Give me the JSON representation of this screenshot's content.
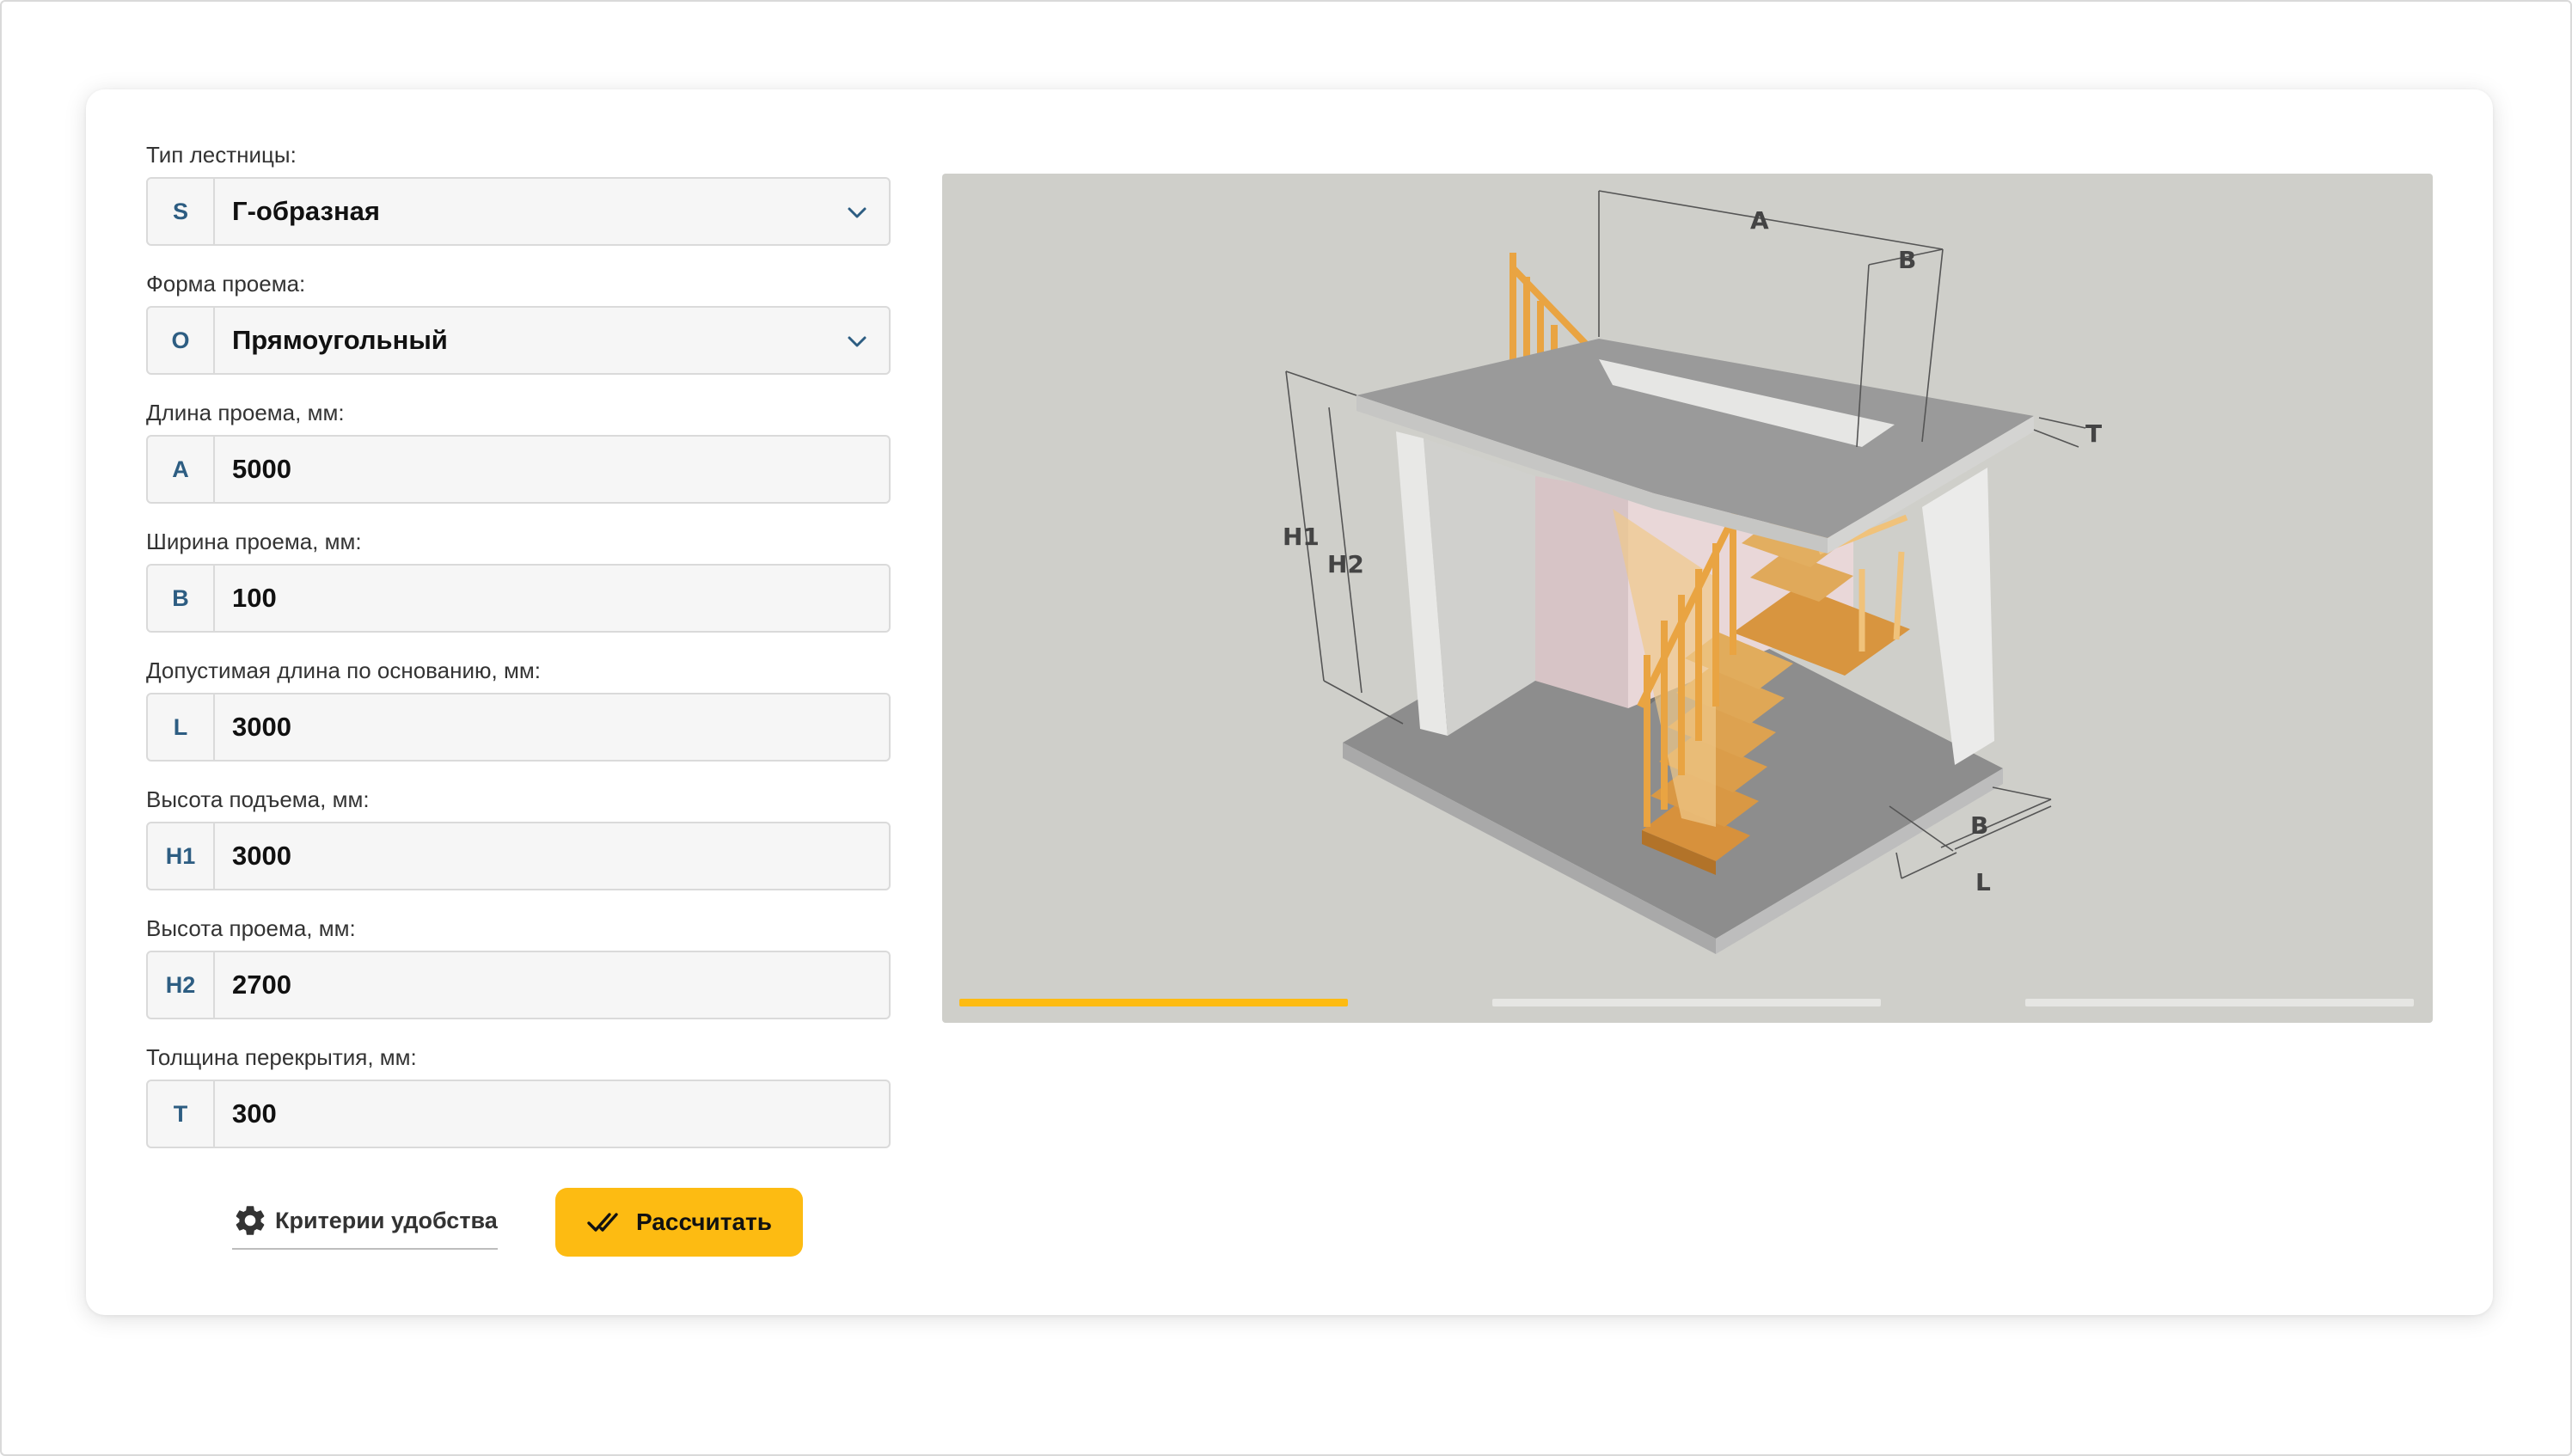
{
  "form": {
    "fields": [
      {
        "label": "Тип лестницы:",
        "prefix": "S",
        "value": "Г-образная",
        "type": "select"
      },
      {
        "label": "Форма проема:",
        "prefix": "O",
        "value": "Прямоугольный",
        "type": "select"
      },
      {
        "label": "Длина проема, мм:",
        "prefix": "A",
        "value": "5000",
        "type": "input"
      },
      {
        "label": "Ширина проема, мм:",
        "prefix": "B",
        "value": "100",
        "type": "input"
      },
      {
        "label": "Допустимая длина по основанию, мм:",
        "prefix": "L",
        "value": "3000",
        "type": "input"
      },
      {
        "label": "Высота подъема, мм:",
        "prefix": "H1",
        "value": "3000",
        "type": "input"
      },
      {
        "label": "Высота проема, мм:",
        "prefix": "H2",
        "value": "2700",
        "type": "input"
      },
      {
        "label": "Толщина перекрытия, мм:",
        "prefix": "T",
        "value": "300",
        "type": "input"
      }
    ]
  },
  "actions": {
    "criteria_label": "Критерии удобства",
    "calculate_label": "Рассчитать"
  },
  "diagram": {
    "labels": {
      "A": "A",
      "B_top": "B",
      "T": "T",
      "H1": "H1",
      "H2": "H2",
      "B_bottom": "B",
      "L": "L"
    }
  },
  "carousel": {
    "active_index": 0,
    "count": 3
  },
  "colors": {
    "accent": "#fdbb12",
    "prefix_text": "#2d5d82",
    "viewer_bg": "#cfcfca"
  }
}
